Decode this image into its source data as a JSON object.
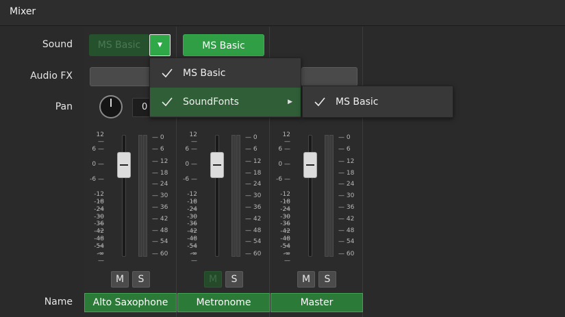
{
  "header": {
    "title": "Mixer"
  },
  "row_labels": {
    "sound": "Sound",
    "audio_fx": "Audio FX",
    "pan": "Pan",
    "name": "Name"
  },
  "channels": [
    {
      "name": "Alto Saxophone",
      "sound": "MS Basic",
      "pan": "0",
      "mute": "M",
      "solo": "S"
    },
    {
      "name": "Metronome",
      "sound": "MS Basic",
      "mute": "M",
      "solo": "S"
    },
    {
      "name": "Master",
      "mute": "M",
      "solo": "S"
    }
  ],
  "scale_left": [
    "12",
    "6",
    "0",
    "-6",
    "-12",
    "-18",
    "-24",
    "-30",
    "-36",
    "-42",
    "-48",
    "-54",
    "-∞"
  ],
  "scale_right": [
    "0",
    "6",
    "12",
    "18",
    "24",
    "30",
    "36",
    "42",
    "48",
    "54",
    "60"
  ],
  "sound_menu": {
    "items": [
      {
        "label": "MS Basic",
        "checked": true,
        "submenu": false,
        "highlighted": false
      },
      {
        "label": "SoundFonts",
        "checked": true,
        "submenu": true,
        "highlighted": true
      }
    ]
  },
  "soundfonts_submenu": {
    "items": [
      {
        "label": "MS Basic",
        "checked": true
      }
    ]
  },
  "colors": {
    "accent_green": "#2f9e44",
    "name_green": "#2c7a38",
    "menu_highlight": "#2f5e37"
  }
}
